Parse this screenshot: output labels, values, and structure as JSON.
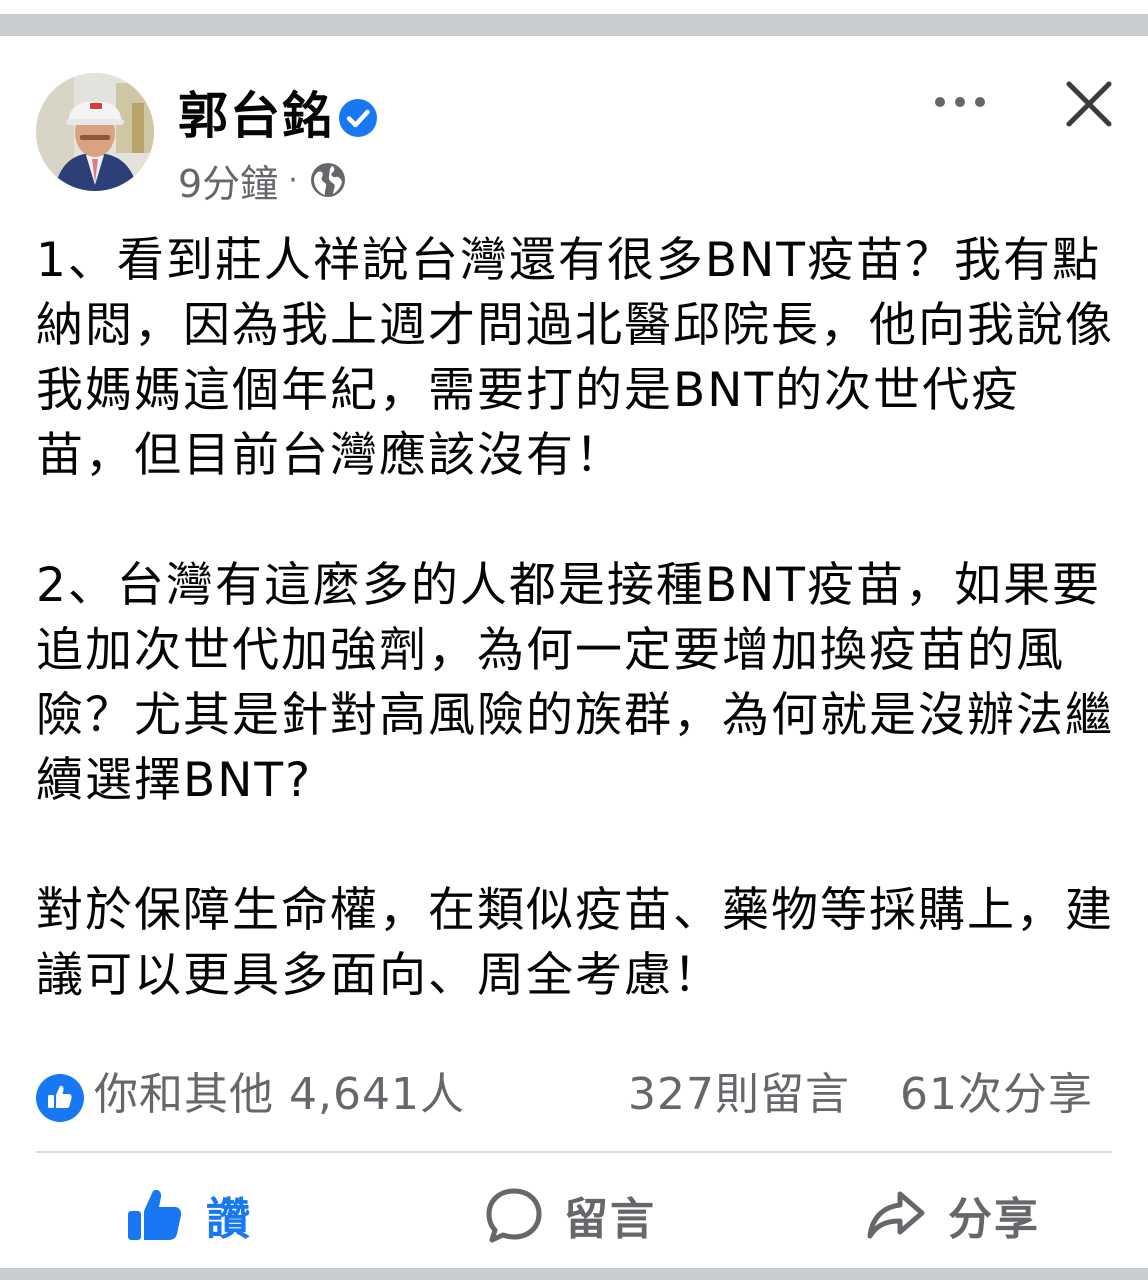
{
  "header": {
    "author_name": "郭台銘",
    "timestamp": "9分鐘",
    "separator": "·",
    "privacy_icon": "globe-icon",
    "verified_icon": "verified-badge-icon",
    "more_icon": "more-horizontal-icon",
    "close_icon": "close-icon"
  },
  "post": {
    "paragraphs": [
      "1、看到莊人祥說台灣還有很多BNT疫苗？我有點納悶，因為我上週才問過北醫邱院長，他向我說像我媽媽這個年紀，需要打的是BNT的次世代疫苗，但目前台灣應該沒有！",
      "2、台灣有這麼多的人都是接種BNT疫苗，如果要追加次世代加強劑，為何一定要增加換疫苗的風險？尤其是針對高風險的族群，為何就是沒辦法繼續選擇BNT?",
      "對於保障生命權，在類似疫苗、藥物等採購上，建議可以更具多面向、周全考慮！"
    ]
  },
  "stats": {
    "reactions": "你和其他 4,641人",
    "comments": "327則留言",
    "shares": "61次分享"
  },
  "actions": {
    "like_label": "讚",
    "comment_label": "留言",
    "share_label": "分享"
  },
  "colors": {
    "accent": "#1877f2",
    "secondary_text": "#65676b",
    "primary_text": "#050505",
    "divider": "#dadde1",
    "frame_gray": "#c9ccd1"
  }
}
